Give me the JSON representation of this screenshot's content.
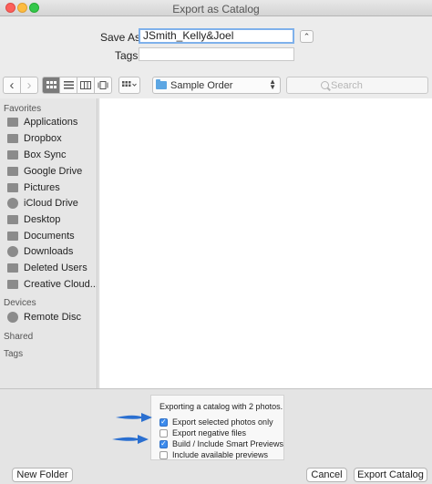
{
  "window": {
    "title": "Export as Catalog"
  },
  "save": {
    "label": "Save As:",
    "value": "JSmith_Kelly&Joel",
    "tags_label": "Tags:",
    "tags_value": "",
    "expand_glyph": "⌃"
  },
  "toolbar": {
    "back_glyph": "‹",
    "forward_glyph": "›",
    "views": [
      "icon-view",
      "list-view",
      "column-view",
      "coverflow-view"
    ],
    "active_view": "icon-view",
    "location": "Sample Order",
    "search_placeholder": "Search"
  },
  "sidebar": {
    "favorites_heading": "Favorites",
    "favorites": [
      {
        "label": "Applications",
        "icon": "applications-icon"
      },
      {
        "label": "Dropbox",
        "icon": "dropbox-icon"
      },
      {
        "label": "Box Sync",
        "icon": "folder-icon"
      },
      {
        "label": "Google Drive",
        "icon": "folder-icon"
      },
      {
        "label": "Pictures",
        "icon": "pictures-icon"
      },
      {
        "label": "iCloud Drive",
        "icon": "cloud-icon"
      },
      {
        "label": "Desktop",
        "icon": "desktop-icon"
      },
      {
        "label": "Documents",
        "icon": "documents-icon"
      },
      {
        "label": "Downloads",
        "icon": "downloads-icon"
      },
      {
        "label": "Deleted Users",
        "icon": "folder-icon"
      },
      {
        "label": "Creative Cloud...",
        "icon": "folder-icon"
      }
    ],
    "devices_heading": "Devices",
    "devices": [
      {
        "label": "Remote Disc",
        "icon": "disc-icon"
      }
    ],
    "shared_heading": "Shared",
    "tags_heading": "Tags"
  },
  "options": {
    "heading": "Exporting a catalog with 2 photos.",
    "items": [
      {
        "label": "Export selected photos only",
        "checked": true
      },
      {
        "label": "Export negative files",
        "checked": false
      },
      {
        "label": "Build / Include Smart Previews",
        "checked": true
      },
      {
        "label": "Include available previews",
        "checked": false
      }
    ]
  },
  "buttons": {
    "new_folder": "New Folder",
    "cancel": "Cancel",
    "export": "Export Catalog"
  },
  "colors": {
    "accent": "#3b8bed",
    "arrow": "#2a6fd0",
    "folder": "#5ca6e3"
  }
}
